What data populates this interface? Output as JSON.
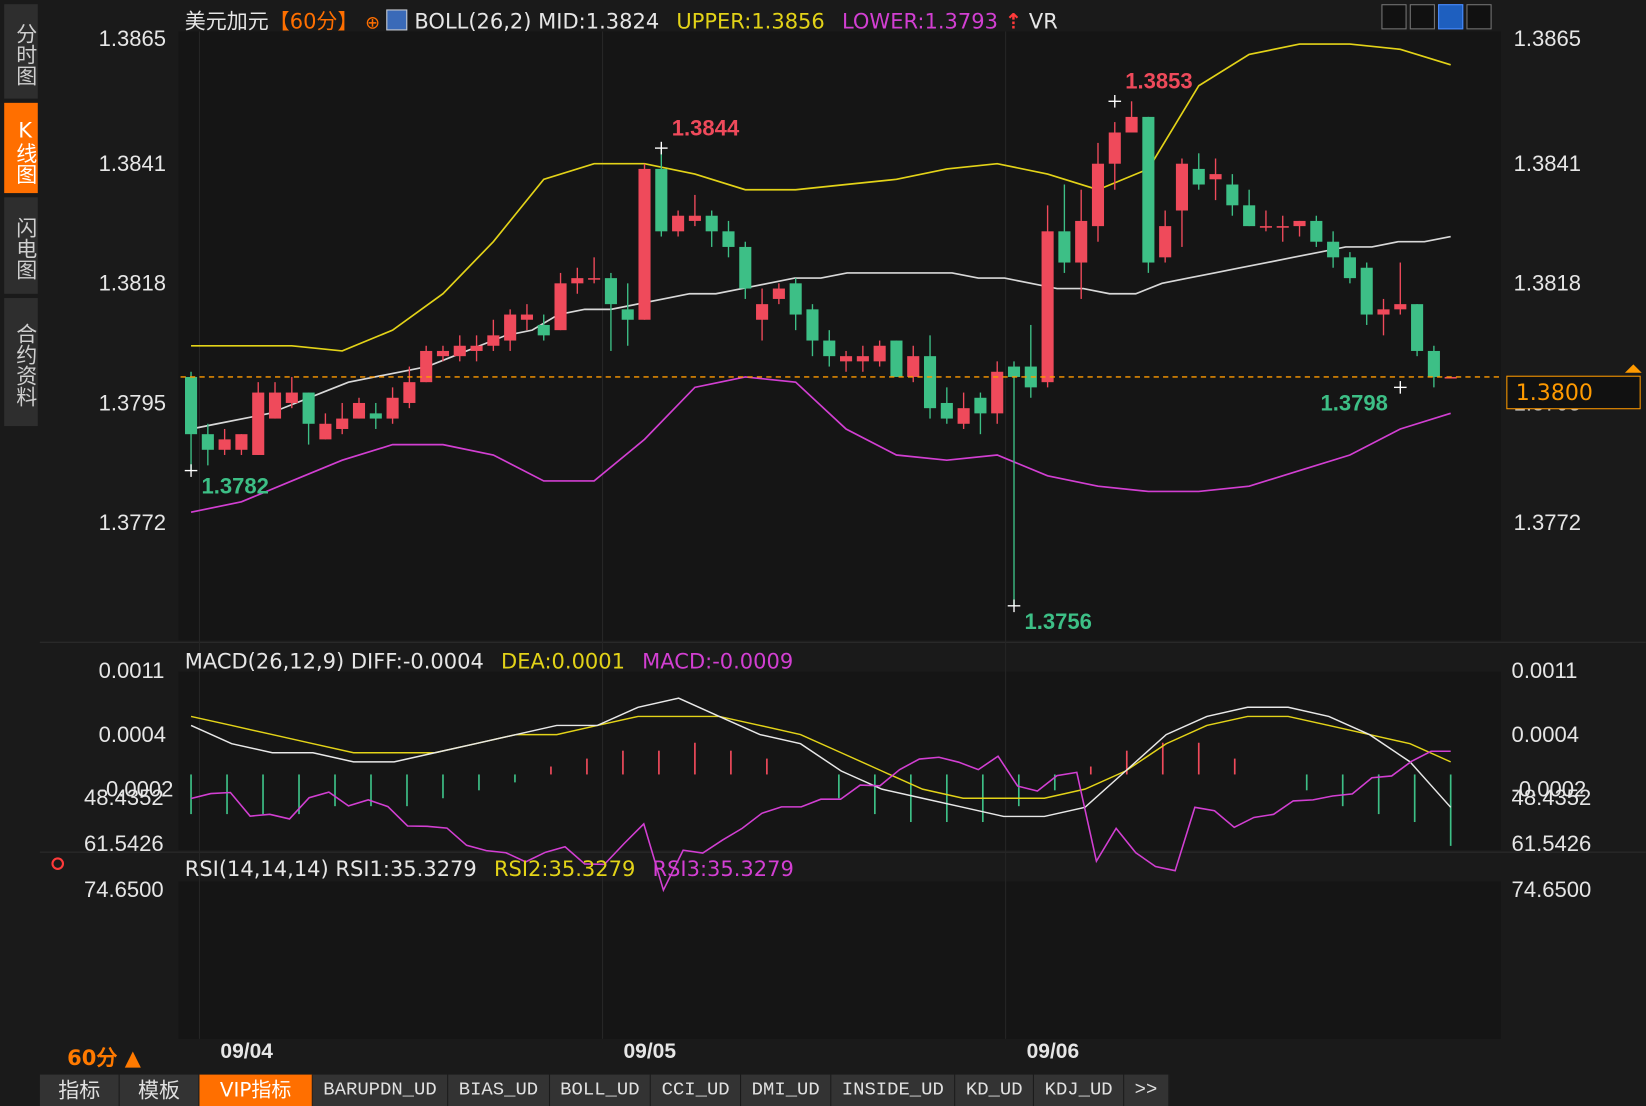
{
  "sidebar": {
    "tabs": [
      {
        "label": "分时图",
        "active": false
      },
      {
        "label": "K线图",
        "active": true
      },
      {
        "label": "闪电图",
        "active": false
      },
      {
        "label": "合约资料",
        "active": false
      }
    ]
  },
  "header": {
    "symbol": "美元加元",
    "period_tag": "【60分】",
    "indicator_name": "BOLL(26,2)",
    "mid": "MID:1.3824",
    "upper": "UPPER:1.3856",
    "lower": "LOWER:1.3793",
    "vr": "VR"
  },
  "macd_header": {
    "name": "MACD(26,12,9)",
    "diff": "DIFF:-0.0004",
    "dea": "DEA:0.0001",
    "macd": "MACD:-0.0009"
  },
  "rsi_header": {
    "name": "RSI(14,14,14)",
    "rsi1": "RSI1:35.3279",
    "rsi2": "RSI2:35.3279",
    "rsi3": "RSI3:35.3279"
  },
  "current_price": "1.3800",
  "period_label": "60分",
  "bottom_tabs": [
    {
      "label": "指标",
      "kind": "cjk"
    },
    {
      "label": "模板",
      "kind": "cjk"
    },
    {
      "label": "VIP指标",
      "kind": "vip"
    },
    {
      "label": "BARUPDN_UD",
      "kind": "ind"
    },
    {
      "label": "BIAS_UD",
      "kind": "ind"
    },
    {
      "label": "BOLL_UD",
      "kind": "ind"
    },
    {
      "label": "CCI_UD",
      "kind": "ind"
    },
    {
      "label": "DMI_UD",
      "kind": "ind"
    },
    {
      "label": "INSIDE_UD",
      "kind": "ind"
    },
    {
      "label": "KD_UD",
      "kind": "ind"
    },
    {
      "label": "KDJ_UD",
      "kind": "ind"
    },
    {
      "label": ">>",
      "kind": "ind"
    }
  ],
  "colors": {
    "up": "#ef4a5b",
    "down": "#3dbf86",
    "boll_mid": "#d8d8d8",
    "boll_upper": "#e3d318",
    "boll_lower": "#d23fd2",
    "macd_diff": "#e8e8e8",
    "macd_dea": "#e3d318",
    "rsi": "#d23fd2",
    "accent": "#ff9a00"
  },
  "chart_data": [
    {
      "type": "candlestick",
      "title": "美元加元【60分】 BOLL(26,2)",
      "x_labels": [
        "09/04",
        "09/05",
        "09/06"
      ],
      "y_ticks": [
        "1.3865",
        "1.3841",
        "1.3818",
        "1.3795",
        "1.3772"
      ],
      "ylim": [
        1.375,
        1.387
      ],
      "annotations": [
        {
          "label": "1.3782",
          "kind": "low"
        },
        {
          "label": "1.3844",
          "kind": "high"
        },
        {
          "label": "1.3756",
          "kind": "low"
        },
        {
          "label": "1.3853",
          "kind": "high"
        },
        {
          "label": "1.3798",
          "kind": "low"
        }
      ],
      "current_price_line": 1.38,
      "candles": [
        [
          1.38,
          1.3789,
          1.3801,
          1.3782
        ],
        [
          1.3789,
          1.3786,
          1.3791,
          1.3783
        ],
        [
          1.3786,
          1.3788,
          1.379,
          1.3785
        ],
        [
          1.3786,
          1.3789,
          1.3789,
          1.3785
        ],
        [
          1.3785,
          1.3797,
          1.3799,
          1.3785
        ],
        [
          1.3792,
          1.3797,
          1.3799,
          1.3792
        ],
        [
          1.3795,
          1.3797,
          1.38,
          1.3794
        ],
        [
          1.3797,
          1.3791,
          1.3797,
          1.3787
        ],
        [
          1.3788,
          1.3791,
          1.3793,
          1.3788
        ],
        [
          1.379,
          1.3792,
          1.3795,
          1.3789
        ],
        [
          1.3792,
          1.3795,
          1.3796,
          1.3792
        ],
        [
          1.3793,
          1.3792,
          1.3795,
          1.379
        ],
        [
          1.3792,
          1.3796,
          1.3798,
          1.3791
        ],
        [
          1.3795,
          1.3799,
          1.3802,
          1.3794
        ],
        [
          1.3799,
          1.3805,
          1.3806,
          1.3799
        ],
        [
          1.3804,
          1.3805,
          1.3806,
          1.3803
        ],
        [
          1.3804,
          1.3806,
          1.3808,
          1.3803
        ],
        [
          1.3805,
          1.3806,
          1.3808,
          1.3803
        ],
        [
          1.3806,
          1.3808,
          1.3811,
          1.3805
        ],
        [
          1.3807,
          1.3812,
          1.3813,
          1.3805
        ],
        [
          1.3811,
          1.3812,
          1.3814,
          1.3809
        ],
        [
          1.381,
          1.3808,
          1.3812,
          1.3807
        ],
        [
          1.3809,
          1.3818,
          1.382,
          1.3809
        ],
        [
          1.3818,
          1.3819,
          1.3821,
          1.3816
        ],
        [
          1.3819,
          1.3819,
          1.3823,
          1.3818
        ],
        [
          1.3819,
          1.3814,
          1.382,
          1.3805
        ],
        [
          1.3813,
          1.3811,
          1.3818,
          1.3806
        ],
        [
          1.3811,
          1.384,
          1.3841,
          1.3811
        ],
        [
          1.384,
          1.3828,
          1.3844,
          1.3827
        ],
        [
          1.3828,
          1.3831,
          1.3832,
          1.3827
        ],
        [
          1.383,
          1.3831,
          1.3835,
          1.3829
        ],
        [
          1.3831,
          1.3828,
          1.3832,
          1.3825
        ],
        [
          1.3828,
          1.3825,
          1.383,
          1.3823
        ],
        [
          1.3825,
          1.3817,
          1.3826,
          1.3815
        ],
        [
          1.3811,
          1.3814,
          1.3817,
          1.3807
        ],
        [
          1.3815,
          1.3817,
          1.3818,
          1.3814
        ],
        [
          1.3818,
          1.3812,
          1.3819,
          1.3809
        ],
        [
          1.3813,
          1.3807,
          1.3814,
          1.3804
        ],
        [
          1.3807,
          1.3804,
          1.3809,
          1.3802
        ],
        [
          1.3803,
          1.3804,
          1.3805,
          1.3801
        ],
        [
          1.3803,
          1.3804,
          1.3806,
          1.3801
        ],
        [
          1.3803,
          1.3806,
          1.3807,
          1.3802
        ],
        [
          1.3807,
          1.38,
          1.3807,
          1.38
        ],
        [
          1.38,
          1.3804,
          1.3806,
          1.3799
        ],
        [
          1.3804,
          1.3794,
          1.3808,
          1.3792
        ],
        [
          1.3795,
          1.3792,
          1.3798,
          1.3791
        ],
        [
          1.3791,
          1.3794,
          1.3797,
          1.379
        ],
        [
          1.3796,
          1.3793,
          1.3797,
          1.3789
        ],
        [
          1.3793,
          1.3801,
          1.3803,
          1.3791
        ],
        [
          1.3802,
          1.38,
          1.3803,
          1.3756
        ],
        [
          1.3802,
          1.3798,
          1.381,
          1.3796
        ],
        [
          1.3799,
          1.3828,
          1.3833,
          1.3798
        ],
        [
          1.3828,
          1.3822,
          1.3837,
          1.382
        ],
        [
          1.3822,
          1.383,
          1.3836,
          1.3815
        ],
        [
          1.3829,
          1.3841,
          1.3845,
          1.3826
        ],
        [
          1.3841,
          1.3847,
          1.3849,
          1.3836
        ],
        [
          1.3847,
          1.385,
          1.3853,
          1.3848
        ],
        [
          1.385,
          1.3822,
          1.385,
          1.382
        ],
        [
          1.3823,
          1.3829,
          1.3832,
          1.3822
        ],
        [
          1.3832,
          1.3841,
          1.3842,
          1.3825
        ],
        [
          1.384,
          1.3837,
          1.3843,
          1.3836
        ],
        [
          1.3838,
          1.3839,
          1.3842,
          1.3834
        ],
        [
          1.3837,
          1.3833,
          1.3839,
          1.3831
        ],
        [
          1.3833,
          1.3829,
          1.3836,
          1.3829
        ],
        [
          1.3829,
          1.3829,
          1.3832,
          1.3828
        ],
        [
          1.3829,
          1.3829,
          1.3831,
          1.3826
        ],
        [
          1.3829,
          1.383,
          1.383,
          1.3827
        ],
        [
          1.383,
          1.3826,
          1.3831,
          1.3825
        ],
        [
          1.3826,
          1.3823,
          1.3828,
          1.3821
        ],
        [
          1.3823,
          1.3819,
          1.3824,
          1.3818
        ],
        [
          1.3821,
          1.3812,
          1.3822,
          1.381
        ],
        [
          1.3812,
          1.3813,
          1.3815,
          1.3808
        ],
        [
          1.3813,
          1.3814,
          1.3822,
          1.3812
        ],
        [
          1.3814,
          1.3805,
          1.3814,
          1.3804
        ],
        [
          1.3805,
          1.38,
          1.3806,
          1.3798
        ],
        [
          1.38,
          1.38,
          1.38,
          1.38
        ]
      ],
      "boll_mid": [
        1.379,
        1.3791,
        1.3792,
        1.3793,
        1.3795,
        1.3797,
        1.3799,
        1.38,
        1.3801,
        1.3802,
        1.3804,
        1.3806,
        1.3808,
        1.3809,
        1.3812,
        1.3813,
        1.3813,
        1.3814,
        1.3815,
        1.3816,
        1.3816,
        1.3817,
        1.3818,
        1.3819,
        1.3819,
        1.382,
        1.382,
        1.382,
        1.382,
        1.382,
        1.3819,
        1.3819,
        1.3818,
        1.3817,
        1.3817,
        1.3816,
        1.3816,
        1.3818,
        1.3819,
        1.382,
        1.3821,
        1.3822,
        1.3823,
        1.3824,
        1.3825,
        1.3825,
        1.3826,
        1.3826,
        1.3827
      ],
      "boll_upper": [
        1.3806,
        1.3806,
        1.3806,
        1.3805,
        1.3809,
        1.3816,
        1.3826,
        1.3838,
        1.3841,
        1.3841,
        1.3839,
        1.3836,
        1.3836,
        1.3837,
        1.3838,
        1.384,
        1.3841,
        1.3839,
        1.3836,
        1.384,
        1.3856,
        1.3862,
        1.3864,
        1.3864,
        1.3863,
        1.386
      ],
      "boll_lower": [
        1.3774,
        1.3776,
        1.378,
        1.3784,
        1.3787,
        1.3787,
        1.3785,
        1.378,
        1.378,
        1.3788,
        1.3798,
        1.38,
        1.3799,
        1.379,
        1.3785,
        1.3784,
        1.3785,
        1.3781,
        1.3779,
        1.3778,
        1.3778,
        1.3779,
        1.3782,
        1.3785,
        1.379,
        1.3793
      ]
    },
    {
      "type": "bar",
      "title": "MACD(26,12,9)",
      "y_ticks": [
        "0.0011",
        "0.0004",
        "-0.0002"
      ],
      "series": [
        {
          "name": "DIFF",
          "values": [
            0.0005,
            0.0003,
            0.0002,
            0.0002,
            0.0001,
            0.0001,
            0.0002,
            0.0003,
            0.0004,
            0.0005,
            0.0005,
            0.0007,
            0.0008,
            0.0006,
            0.0004,
            0.0003,
            0.0,
            -0.0002,
            -0.0003,
            -0.0004,
            -0.0005,
            -0.0005,
            -0.0004,
            0.0,
            0.0004,
            0.0006,
            0.0007,
            0.0007,
            0.0006,
            0.0004,
            0.0001,
            -0.0004
          ]
        },
        {
          "name": "DEA",
          "values": [
            0.0006,
            0.0005,
            0.0004,
            0.0003,
            0.0002,
            0.0002,
            0.0002,
            0.0003,
            0.0004,
            0.0004,
            0.0005,
            0.0006,
            0.0006,
            0.0006,
            0.0005,
            0.0004,
            0.0002,
            0.0,
            -0.0002,
            -0.0003,
            -0.0003,
            -0.0003,
            -0.0002,
            0.0,
            0.0003,
            0.0005,
            0.0006,
            0.0006,
            0.0005,
            0.0004,
            0.0003,
            0.0001
          ]
        },
        {
          "name": "MACD",
          "values": [
            -0.0005,
            -0.0005,
            -0.0005,
            -0.0005,
            -0.0004,
            -0.0004,
            -0.0004,
            -0.0003,
            -0.0002,
            -0.0001,
            0.0001,
            0.0002,
            0.0003,
            0.0003,
            0.0004,
            0.0003,
            0.0002,
            0.0,
            -0.0003,
            -0.0005,
            -0.0006,
            -0.0006,
            -0.0006,
            -0.0004,
            -0.0002,
            0.0001,
            0.0003,
            0.0004,
            0.0004,
            0.0002,
            0.0,
            -0.0002,
            -0.0004,
            -0.0005,
            -0.0006,
            -0.0009
          ]
        }
      ]
    },
    {
      "type": "line",
      "title": "RSI(14,14,14)",
      "y_ticks": [
        "74.6500",
        "61.5426",
        "48.4352"
      ],
      "ylim": [
        35.3279,
        74.65
      ],
      "series": [
        {
          "name": "RSI1",
          "values": [
            48.7,
            47.3,
            47.0,
            53.7,
            53.2,
            54.5,
            48.5,
            46.9,
            50.8,
            49.1,
            51.0,
            56.5,
            56.6,
            57.1,
            62.0,
            63.5,
            64.1,
            66.7,
            64.0,
            62.4,
            67.3,
            67.4,
            61.5,
            55.9,
            74.7,
            63.4,
            64.2,
            60.5,
            57.2,
            52.9,
            51.1,
            51.1,
            48.9,
            48.9,
            44.9,
            45.1,
            40.5,
            37.5,
            37.0,
            38.4,
            40.5,
            36.7,
            45.2,
            46.6,
            42.2,
            41.3,
            66.5,
            57.2,
            64.1,
            68.0,
            69.2,
            51.2,
            52.2,
            56.9,
            54.1,
            53.2,
            49.4,
            49.1,
            48.0,
            47.4,
            42.8,
            42.3,
            38.2,
            35.3,
            35.3
          ]
        }
      ]
    }
  ]
}
